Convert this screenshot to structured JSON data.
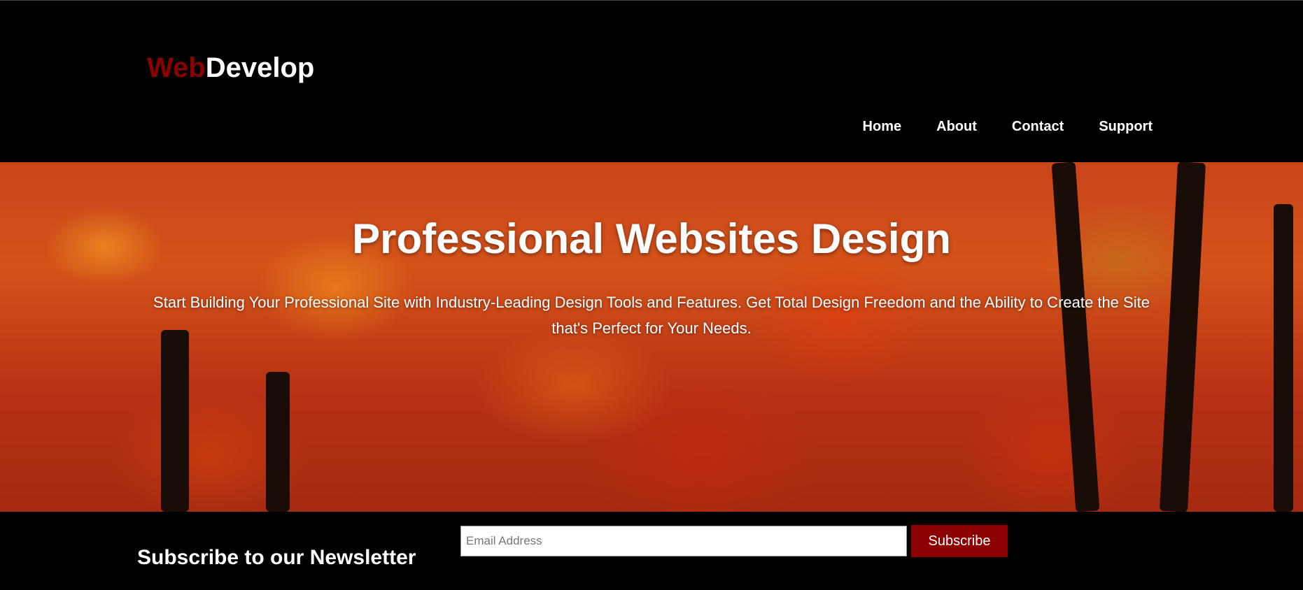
{
  "header": {
    "logo": {
      "part1": "Web",
      "part2": "Develop"
    },
    "nav": [
      {
        "label": "Home"
      },
      {
        "label": "About"
      },
      {
        "label": "Contact"
      },
      {
        "label": "Support"
      }
    ]
  },
  "hero": {
    "title": "Professional Websites Design",
    "subtitle": "Start Building Your Professional Site with Industry-Leading Design Tools and Features. Get Total Design Freedom and the Ability to Create the Site that's Perfect for Your Needs."
  },
  "newsletter": {
    "title": "Subscribe to our Newsletter",
    "email_placeholder": "Email Address",
    "button_label": "Subscribe"
  },
  "colors": {
    "accent": "#8b0000",
    "background": "#000000",
    "text": "#ffffff"
  }
}
